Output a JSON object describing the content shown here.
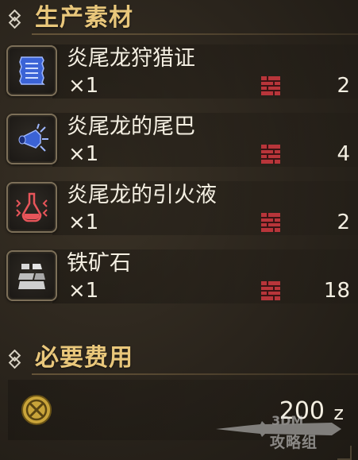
{
  "sections": {
    "materials": {
      "title": "生产素材",
      "icon": "diamond-emblem-icon"
    },
    "cost": {
      "title": "必要费用",
      "icon": "diamond-emblem-icon"
    }
  },
  "materials": [
    {
      "name": "炎尾龙狩猎证",
      "qty": "×1",
      "owned": "2",
      "icon": "blue-certificate-icon",
      "owned_icon": "item-box-icon"
    },
    {
      "name": "炎尾龙的尾巴",
      "qty": "×1",
      "owned": "4",
      "icon": "blue-tail-icon",
      "owned_icon": "item-box-icon"
    },
    {
      "name": "炎尾龙的引火液",
      "qty": "×1",
      "owned": "2",
      "icon": "red-flask-icon",
      "owned_icon": "item-box-icon"
    },
    {
      "name": "铁矿石",
      "qty": "×1",
      "owned": "18",
      "icon": "grey-ore-icon",
      "owned_icon": "item-box-icon"
    }
  ],
  "cost": {
    "value": "200",
    "unit": "z",
    "icon": "zenny-coin-icon"
  },
  "watermark": {
    "logo": "3DM",
    "text": "攻略组"
  },
  "colors": {
    "header_gold": "#e9c77b",
    "text": "#f4efe2",
    "box_red": "#b8353a",
    "frame": "#7c6f58"
  }
}
